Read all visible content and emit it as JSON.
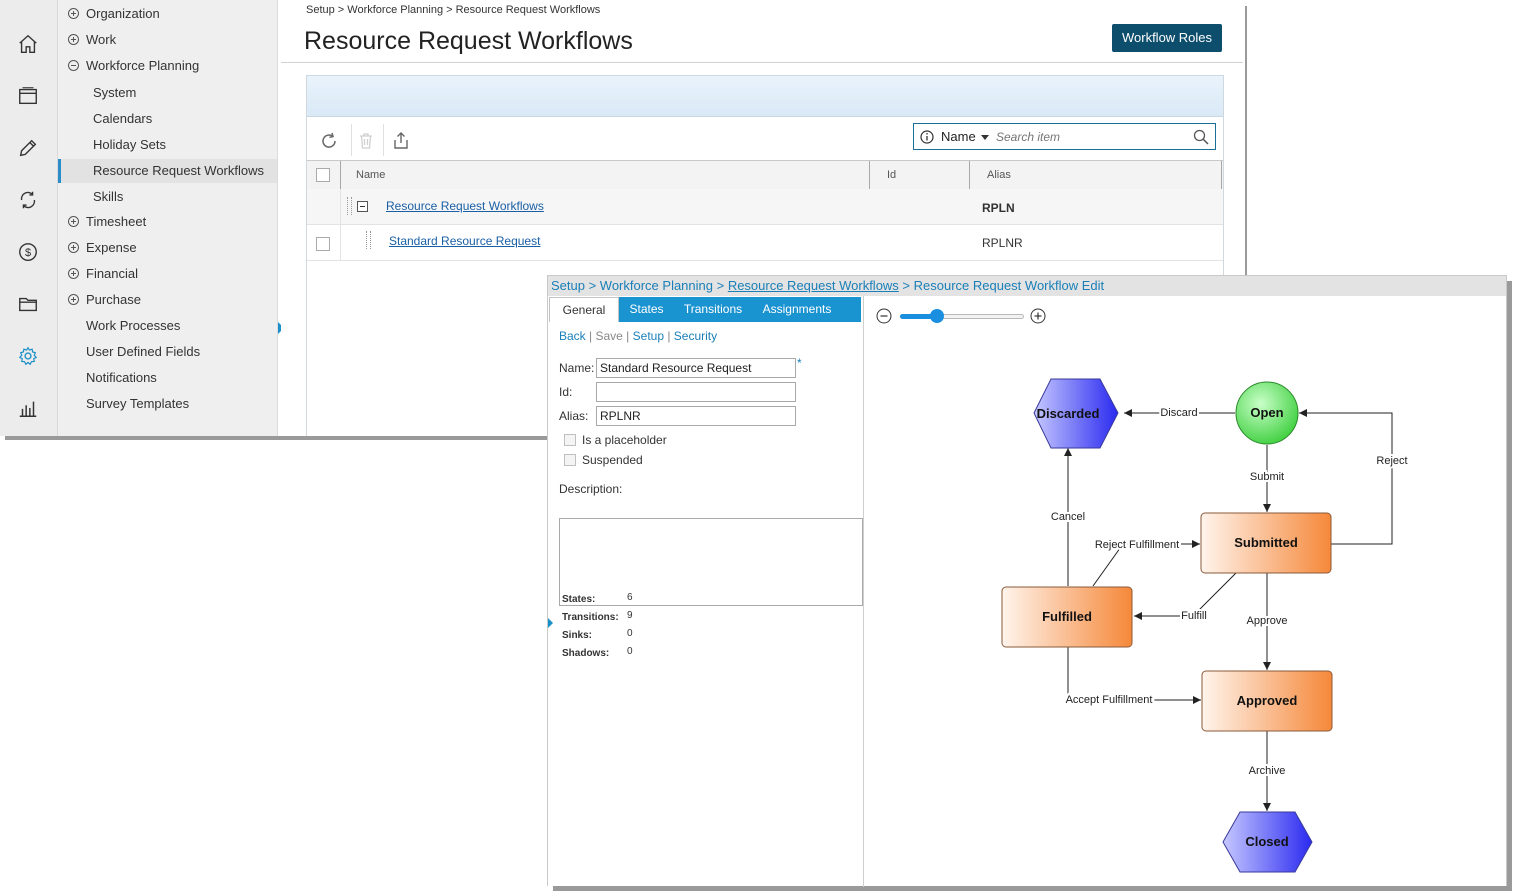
{
  "sidebar_icons": [
    "home-icon",
    "browser-window-icon",
    "pencil-icon",
    "sync-icon",
    "dollar-icon",
    "folder-icon",
    "gear-icon",
    "bar-chart-icon"
  ],
  "nav": {
    "items": [
      {
        "label": "Organization",
        "toggle": "plus"
      },
      {
        "label": "Work",
        "toggle": "plus"
      },
      {
        "label": "Workforce Planning",
        "toggle": "minus"
      },
      {
        "label": "System"
      },
      {
        "label": "Calendars"
      },
      {
        "label": "Holiday Sets"
      },
      {
        "label": "Resource Request Workflows",
        "selected": true
      },
      {
        "label": "Skills"
      },
      {
        "label": "Timesheet",
        "toggle": "plus"
      },
      {
        "label": "Expense",
        "toggle": "plus"
      },
      {
        "label": "Financial",
        "toggle": "plus"
      },
      {
        "label": "Purchase",
        "toggle": "plus"
      },
      {
        "label": "Work Processes"
      },
      {
        "label": "User Defined Fields"
      },
      {
        "label": "Notifications"
      },
      {
        "label": "Survey Templates"
      }
    ]
  },
  "main": {
    "breadcrumb": "Setup > Workforce Planning > Resource Request Workflows",
    "title": "Resource Request Workflows",
    "workflow_roles_button": "Workflow Roles",
    "search": {
      "field": "Name",
      "placeholder": "Search item"
    },
    "grid": {
      "columns": [
        "Name",
        "Id",
        "Alias"
      ],
      "rows": [
        {
          "name": "Resource Request Workflows",
          "id": "",
          "alias": "RPLN"
        },
        {
          "name": "Standard Resource Request",
          "id": "",
          "alias": "RPLNR"
        }
      ]
    }
  },
  "editor": {
    "breadcrumb": {
      "part1": "Setup > Workforce Planning > ",
      "link": "Resource Request Workflows",
      "part2": " > Resource Request Workflow Edit"
    },
    "tabs": [
      "General",
      "States",
      "Transitions",
      "Assignments"
    ],
    "actions": {
      "back": "Back",
      "save": "Save",
      "setup": "Setup",
      "security": "Security"
    },
    "form": {
      "name_label": "Name:",
      "name_value": "Standard Resource Request",
      "id_label": "Id:",
      "id_value": "",
      "alias_label": "Alias:",
      "alias_value": "RPLNR",
      "placeholder_label": "Is a placeholder",
      "suspended_label": "Suspended",
      "description_label": "Description:",
      "description_value": ""
    },
    "stats": [
      {
        "label": "States:",
        "value": "6"
      },
      {
        "label": "Transitions:",
        "value": "9"
      },
      {
        "label": "Sinks:",
        "value": "0"
      },
      {
        "label": "Shadows:",
        "value": "0"
      }
    ],
    "zoom_level": 0.3
  },
  "workflow": {
    "states": [
      {
        "key": "discarded",
        "label": "Discarded",
        "shape": "hexagon"
      },
      {
        "key": "open",
        "label": "Open",
        "shape": "circle"
      },
      {
        "key": "submitted",
        "label": "Submitted",
        "shape": "rect"
      },
      {
        "key": "fulfilled",
        "label": "Fulfilled",
        "shape": "rect"
      },
      {
        "key": "approved",
        "label": "Approved",
        "shape": "rect"
      },
      {
        "key": "closed",
        "label": "Closed",
        "shape": "hexagon"
      }
    ],
    "transitions": [
      {
        "key": "discard",
        "label": "Discard"
      },
      {
        "key": "submit",
        "label": "Submit"
      },
      {
        "key": "reject",
        "label": "Reject"
      },
      {
        "key": "cancel",
        "label": "Cancel"
      },
      {
        "key": "reject-fulfillment",
        "label": "Reject Fulfillment"
      },
      {
        "key": "fulfill",
        "label": "Fulfill"
      },
      {
        "key": "approve",
        "label": "Approve"
      },
      {
        "key": "accept-fulfillment",
        "label": "Accept Fulfillment"
      },
      {
        "key": "archive",
        "label": "Archive"
      }
    ],
    "colors": {
      "hexagon_fill": "#5a5ef0",
      "circle_fill": "#44d444",
      "rect_fill": "#f5883a",
      "edge": "#222222"
    }
  }
}
